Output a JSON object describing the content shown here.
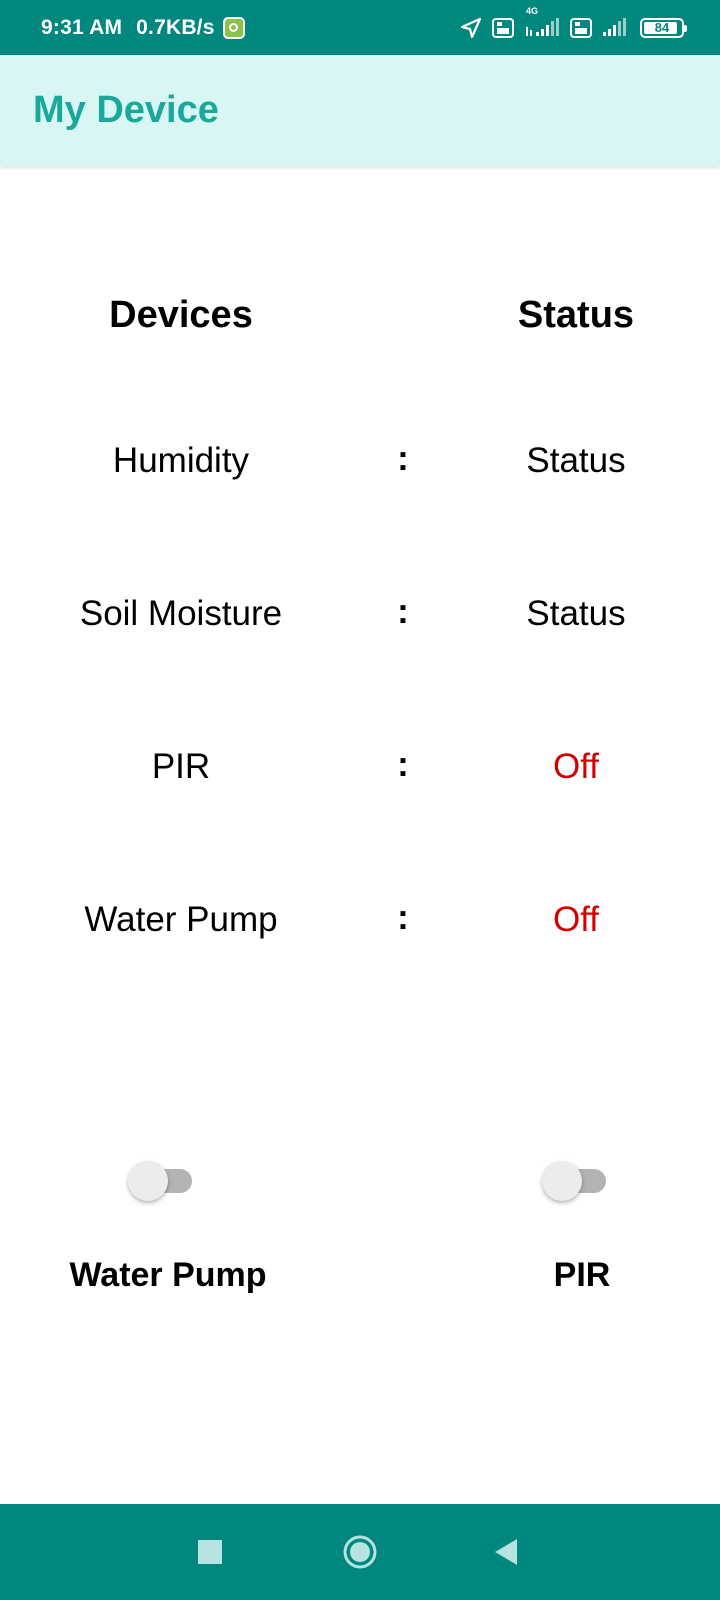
{
  "status_bar": {
    "time": "9:31 AM",
    "net_speed": "0.7KB/s",
    "network_label": "4G",
    "battery_level": "84",
    "icons": [
      "app-notification-icon",
      "location-icon",
      "volte-icon",
      "signal-icon",
      "volte-icon",
      "signal-icon",
      "battery-icon"
    ]
  },
  "app_bar": {
    "title": "My Device"
  },
  "table": {
    "header_devices": "Devices",
    "header_status": "Status",
    "separator": ":",
    "rows": [
      {
        "device": "Humidity",
        "status": "Status"
      },
      {
        "device": "Soil Moisture",
        "status": "Status"
      },
      {
        "device": "PIR",
        "status": "Off"
      },
      {
        "device": "Water Pump",
        "status": "Off"
      }
    ]
  },
  "controls": {
    "water_pump": {
      "label": "Water Pump",
      "on": false
    },
    "pir": {
      "label": "PIR",
      "on": false
    }
  },
  "colors": {
    "status_bar": "#00887f",
    "app_bar": "#d8f7f4",
    "title": "#1aa89b",
    "off_status": "#d40000"
  },
  "nav_bar": {
    "icons": [
      "recents-square-icon",
      "home-circle-icon",
      "back-triangle-icon"
    ]
  }
}
